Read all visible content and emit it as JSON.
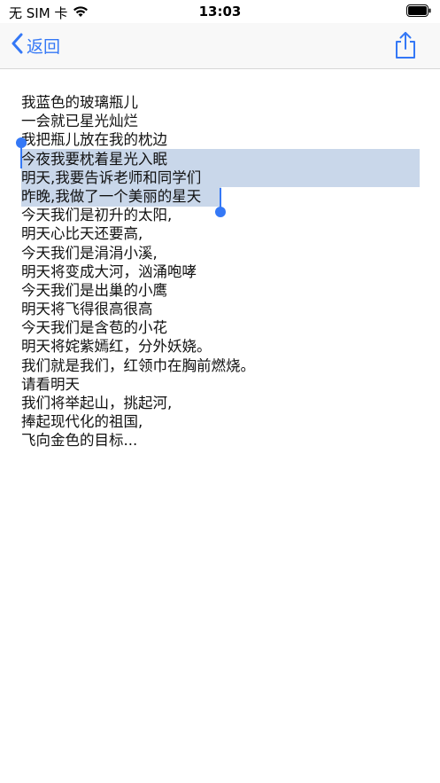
{
  "status_bar": {
    "carrier": "无 SIM 卡",
    "time": "13:03",
    "wifi_icon": "wifi-icon",
    "battery_icon": "battery-icon"
  },
  "nav_bar": {
    "back_label": "返回",
    "back_icon": "chevron-left-icon",
    "share_icon": "share-icon",
    "accent_color": "#3478f6"
  },
  "text": {
    "lines": [
      "我蓝色的玻璃瓶儿",
      "一会就已星光灿烂",
      "我把瓶儿放在我的枕边",
      "今夜我要枕着星光入眠",
      "明天,我要告诉老师和同学们",
      "昨晚,我做了一个美丽的星天",
      "今天我们是初升的太阳,",
      "明天心比天还要高,",
      "今天我们是涓涓小溪,",
      "明天将变成大河，汹涌咆哮",
      "今天我们是出巢的小鹰",
      "明天将飞得很高很高",
      "今天我们是含苞的小花",
      "明天将姹紫嫣红，分外妖娆。",
      "我们就是我们，红领巾在胸前燃烧。",
      "请看明天",
      "我们将举起山，挑起河,",
      "捧起现代化的祖国,",
      "飞向金色的目标..."
    ],
    "selection_color": "#c9d7ea"
  }
}
